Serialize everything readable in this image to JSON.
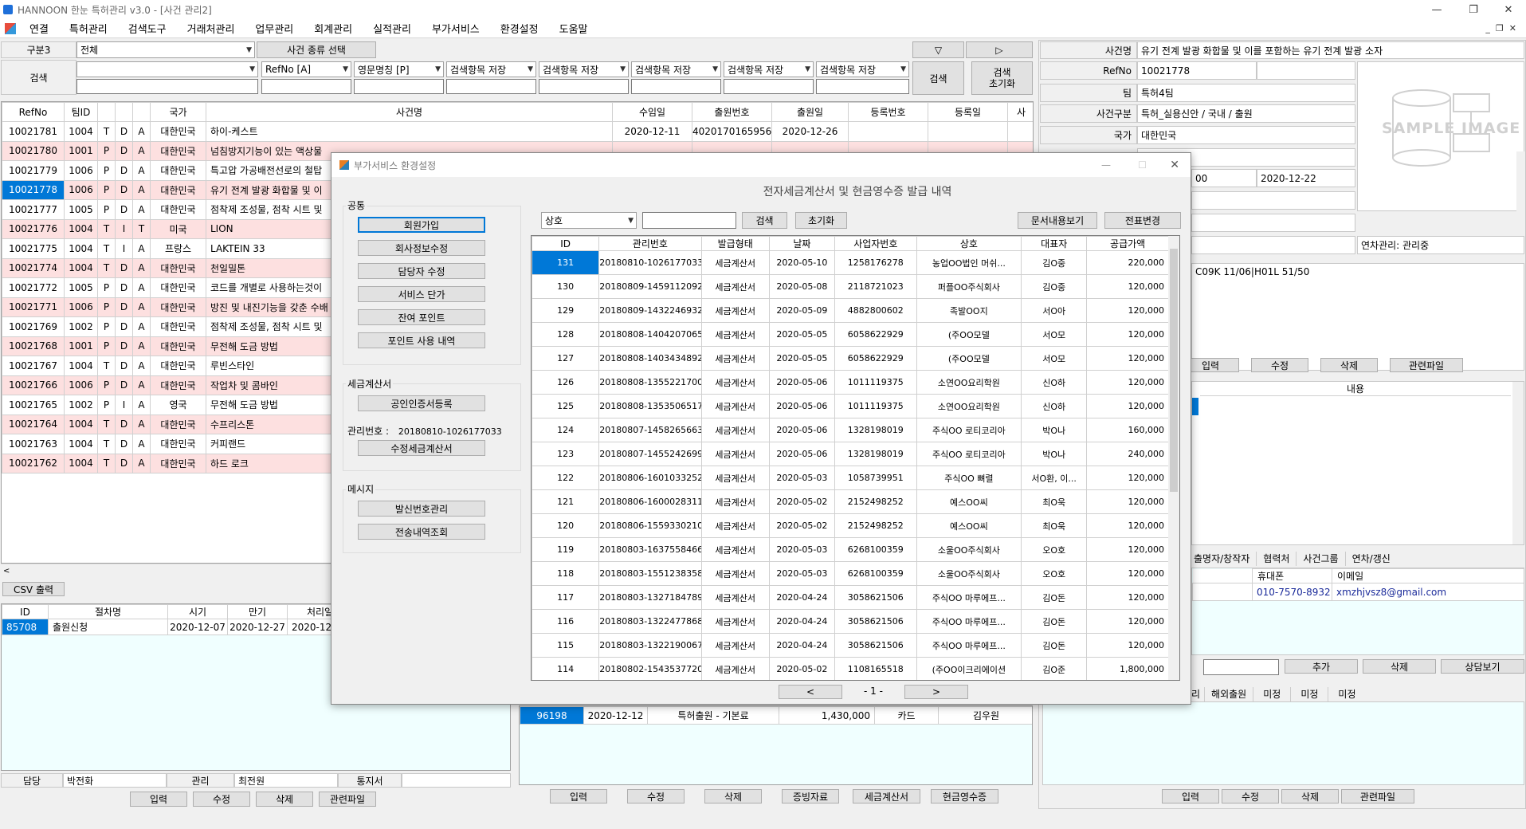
{
  "window": {
    "title": "HANNOON 한눈 특허관리 v3.0 - [사건 관리2]",
    "min": "—",
    "max": "❐",
    "close": "✕"
  },
  "menu": [
    "연결",
    "특허관리",
    "검색도구",
    "거래처관리",
    "업무관리",
    "회계관리",
    "실적관리",
    "부가서비스",
    "환경설정",
    "도움말"
  ],
  "search": {
    "gubun_label": "구분3",
    "gubun_value": "전체",
    "case_type_btn": "사건 종류 선택",
    "search_label": "검색",
    "search_btn": "검색",
    "reset_btn": "검색\n초기화",
    "fields": [
      "RefNo [A]",
      "영문명칭 [P]",
      "검색항목 저장",
      "검색항목 저장",
      "검색항목 저장",
      "검색항목 저장",
      "검색항목 저장"
    ],
    "nav_down": "▽",
    "nav_right": "▷"
  },
  "cases": {
    "headers": [
      "RefNo",
      "팀ID",
      "",
      "",
      "",
      "국가",
      "사건명",
      "수임일",
      "출원번호",
      "출원일",
      "등록번호",
      "등록일",
      "사"
    ],
    "rows": [
      [
        "10021781",
        "1004",
        "T",
        "D",
        "A",
        "대한민국",
        "하이-케스트",
        "2020-12-11",
        "4020170165956",
        "2020-12-26",
        "",
        "",
        ""
      ],
      [
        "10021780",
        "1001",
        "P",
        "D",
        "A",
        "대한민국",
        "넘침방지기능이 있는 액상물",
        "",
        "",
        "",
        "",
        "",
        ""
      ],
      [
        "10021779",
        "1006",
        "P",
        "D",
        "A",
        "대한민국",
        "특고압 가공배전선로의 철탑",
        "",
        "",
        "",
        "",
        "",
        ""
      ],
      [
        "10021778",
        "1006",
        "P",
        "D",
        "A",
        "대한민국",
        "유기 전계 발광 화합물 및 이",
        "",
        "",
        "",
        "",
        "",
        ""
      ],
      [
        "10021777",
        "1005",
        "P",
        "D",
        "A",
        "대한민국",
        "점착제 조성물, 점착 시트 및",
        "",
        "",
        "",
        "",
        "",
        ""
      ],
      [
        "10021776",
        "1004",
        "T",
        "I",
        "T",
        "미국",
        "LION",
        "",
        "",
        "",
        "",
        "",
        ""
      ],
      [
        "10021775",
        "1004",
        "T",
        "I",
        "A",
        "프랑스",
        "LAKTEIN 33",
        "",
        "",
        "",
        "",
        "",
        ""
      ],
      [
        "10021774",
        "1004",
        "T",
        "D",
        "A",
        "대한민국",
        "천일밀톤",
        "",
        "",
        "",
        "",
        "",
        ""
      ],
      [
        "10021772",
        "1005",
        "P",
        "D",
        "A",
        "대한민국",
        "코드를 개별로 사용하는것이",
        "",
        "",
        "",
        "",
        "",
        ""
      ],
      [
        "10021771",
        "1006",
        "P",
        "D",
        "A",
        "대한민국",
        "방진 및 내진기능을 갖춘 수배",
        "",
        "",
        "",
        "",
        "",
        ""
      ],
      [
        "10021769",
        "1002",
        "P",
        "D",
        "A",
        "대한민국",
        "점착제 조성물, 점착 시트 및",
        "",
        "",
        "",
        "",
        "",
        ""
      ],
      [
        "10021768",
        "1001",
        "P",
        "D",
        "A",
        "대한민국",
        "무전해 도금 방법",
        "",
        "",
        "",
        "",
        "",
        ""
      ],
      [
        "10021767",
        "1004",
        "T",
        "D",
        "A",
        "대한민국",
        "루빈스타인",
        "",
        "",
        "",
        "",
        "",
        ""
      ],
      [
        "10021766",
        "1006",
        "P",
        "D",
        "A",
        "대한민국",
        "작업차 및 콤바인",
        "",
        "",
        "",
        "",
        "",
        ""
      ],
      [
        "10021765",
        "1002",
        "P",
        "I",
        "A",
        "영국",
        "무전해 도금 방법",
        "",
        "",
        "",
        "",
        "",
        ""
      ],
      [
        "10021764",
        "1004",
        "T",
        "D",
        "A",
        "대한민국",
        "수프리스톤",
        "",
        "",
        "",
        "",
        "",
        ""
      ],
      [
        "10021763",
        "1004",
        "T",
        "D",
        "A",
        "대한민국",
        "커피랜드",
        "",
        "",
        "",
        "",
        "",
        ""
      ],
      [
        "10021762",
        "1004",
        "T",
        "D",
        "A",
        "대한민국",
        "하드 로크",
        "",
        "",
        "",
        "",
        "",
        ""
      ]
    ]
  },
  "csv_btn": "CSV 출력",
  "procedures": {
    "headers": [
      "ID",
      "절차명",
      "시기",
      "만기",
      "처리일"
    ],
    "rows": [
      [
        "85708",
        "출원신청",
        "2020-12-07",
        "2020-12-27",
        "2020-12-2"
      ]
    ]
  },
  "bottom_left": {
    "dam_label": "담당",
    "dam_value": "박전화",
    "kwan_label": "관리",
    "kwan_value": "최전원",
    "tongji_label": "통지서",
    "buttons": [
      "입력",
      "수정",
      "삭제",
      "관련파일"
    ]
  },
  "payments": {
    "row": [
      "96198",
      "2020-12-12",
      "특허출원 - 기본료",
      "1,430,000",
      "카드",
      "김우원"
    ],
    "buttons": [
      "입력",
      "수정",
      "삭제",
      "증빙자료",
      "세금계산서",
      "현금영수증"
    ]
  },
  "detail": {
    "case_name_label": "사건명",
    "case_name": "유기 전계 발광 화합물 및 이를 포함하는 유기 전계 발광 소자",
    "refno_label": "RefNo",
    "refno": "10021778",
    "team_label": "팀",
    "team": "특허4팀",
    "case_type_label": "사건구분",
    "case_type": "특허_실용신안 / 국내 / 출원",
    "country_label": "국가",
    "country": "대한민국",
    "partial_date1": "00",
    "partial_date2": "2020-12-22",
    "annuity": "연차관리: 관리중",
    "ipc": "C09K 11/06|H01L 51/50",
    "sample_image": "SAMPLE IMAGE",
    "buttons1": [
      "입력",
      "수정",
      "삭제",
      "관련파일"
    ],
    "content_header": "내용",
    "tabs": [
      "출명자/창작자",
      "협력처",
      "사건그룹",
      "연차/갱신"
    ],
    "contact_headers": [
      "휴대폰",
      "이메일"
    ],
    "contact_row": [
      "010-7570-8932",
      "xmzhjvsz8@gmail.com"
    ],
    "buttons2": [
      "추가",
      "삭제",
      "상담보기"
    ],
    "status_tabs": [
      "리",
      "해외출원",
      "미정",
      "미정",
      "미정"
    ],
    "buttons3": [
      "입력",
      "수정",
      "삭제",
      "관련파일"
    ]
  },
  "dialog": {
    "title": "부가서비스 환경설정",
    "heading": "전자세금계산서 및 현금영수증 발급 내역",
    "group_common": "공통",
    "common_buttons": [
      "회원가입",
      "회사정보수정",
      "담당자 수정",
      "서비스 단가",
      "잔여 포인트",
      "포인트 사용 내역"
    ],
    "group_tax": "세금계산서",
    "tax_cert_btn": "공인인증서등록",
    "mgmt_label": "관리번호 :",
    "mgmt_value": "20180810-1026177033",
    "tax_modify_btn": "수정세금계산서",
    "group_msg": "메시지",
    "msg_buttons": [
      "발신번호관리",
      "전송내역조회"
    ],
    "filter_select": "상호",
    "search_btn": "검색",
    "reset_btn": "초기화",
    "view_doc_btn": "문서내용보기",
    "change_btn": "전표변경",
    "headers": [
      "ID",
      "관리번호",
      "발급형태",
      "날짜",
      "사업자번호",
      "상호",
      "대표자",
      "공급가액"
    ],
    "rows": [
      [
        "131",
        "20180810-1026177033",
        "세금계산서",
        "2020-05-10",
        "1258176278",
        "농업OO법인 머쉬...",
        "김O중",
        "220,000"
      ],
      [
        "130",
        "20180809-1459112092",
        "세금계산서",
        "2020-05-08",
        "2118721023",
        "퍼플OO주식회사",
        "김O중",
        "120,000"
      ],
      [
        "129",
        "20180809-1432246932",
        "세금계산서",
        "2020-05-09",
        "4882800602",
        "족발OO지",
        "서O아",
        "120,000"
      ],
      [
        "128",
        "20180808-1404207065",
        "세금계산서",
        "2020-05-05",
        "6058622929",
        "(주OO모델",
        "서O모",
        "120,000"
      ],
      [
        "127",
        "20180808-1403434892",
        "세금계산서",
        "2020-05-05",
        "6058622929",
        "(주OO모델",
        "서O모",
        "120,000"
      ],
      [
        "126",
        "20180808-1355221700",
        "세금계산서",
        "2020-05-06",
        "1011119375",
        "소연OO요리학원",
        "신O하",
        "120,000"
      ],
      [
        "125",
        "20180808-1353506517",
        "세금계산서",
        "2020-05-06",
        "1011119375",
        "소연OO요리학원",
        "신O하",
        "120,000"
      ],
      [
        "124",
        "20180807-1458265663",
        "세금계산서",
        "2020-05-06",
        "1328198019",
        "주식OO 로티코리아",
        "박O나",
        "160,000"
      ],
      [
        "123",
        "20180807-1455242699",
        "세금계산서",
        "2020-05-06",
        "1328198019",
        "주식OO 로티코리아",
        "박O나",
        "240,000"
      ],
      [
        "122",
        "20180806-1601033252",
        "세금계산서",
        "2020-05-03",
        "1058739951",
        "주식OO 뼈렬",
        "서O환, 이...",
        "120,000"
      ],
      [
        "121",
        "20180806-1600028311",
        "세금계산서",
        "2020-05-02",
        "2152498252",
        "예스OO씨",
        "최O욱",
        "120,000"
      ],
      [
        "120",
        "20180806-1559330210",
        "세금계산서",
        "2020-05-02",
        "2152498252",
        "예스OO씨",
        "최O욱",
        "120,000"
      ],
      [
        "119",
        "20180803-1637558466",
        "세금계산서",
        "2020-05-03",
        "6268100359",
        "소울OO주식회사",
        "오O호",
        "120,000"
      ],
      [
        "118",
        "20180803-1551238358",
        "세금계산서",
        "2020-05-03",
        "6268100359",
        "소울OO주식회사",
        "오O호",
        "120,000"
      ],
      [
        "117",
        "20180803-1327184789",
        "세금계산서",
        "2020-04-24",
        "3058621506",
        "주식OO 마루에프...",
        "김O돈",
        "120,000"
      ],
      [
        "116",
        "20180803-1322477868",
        "세금계산서",
        "2020-04-24",
        "3058621506",
        "주식OO 마루에프...",
        "김O돈",
        "120,000"
      ],
      [
        "115",
        "20180803-1322190067",
        "세금계산서",
        "2020-04-24",
        "3058621506",
        "주식OO 마루에프...",
        "김O돈",
        "120,000"
      ],
      [
        "114",
        "20180802-1543537720",
        "세금계산서",
        "2020-05-02",
        "1108165518",
        "(주OO이크리에이션",
        "김O준",
        "1,800,000"
      ]
    ],
    "page": "- 1 -",
    "prev": "<",
    "next": ">"
  }
}
